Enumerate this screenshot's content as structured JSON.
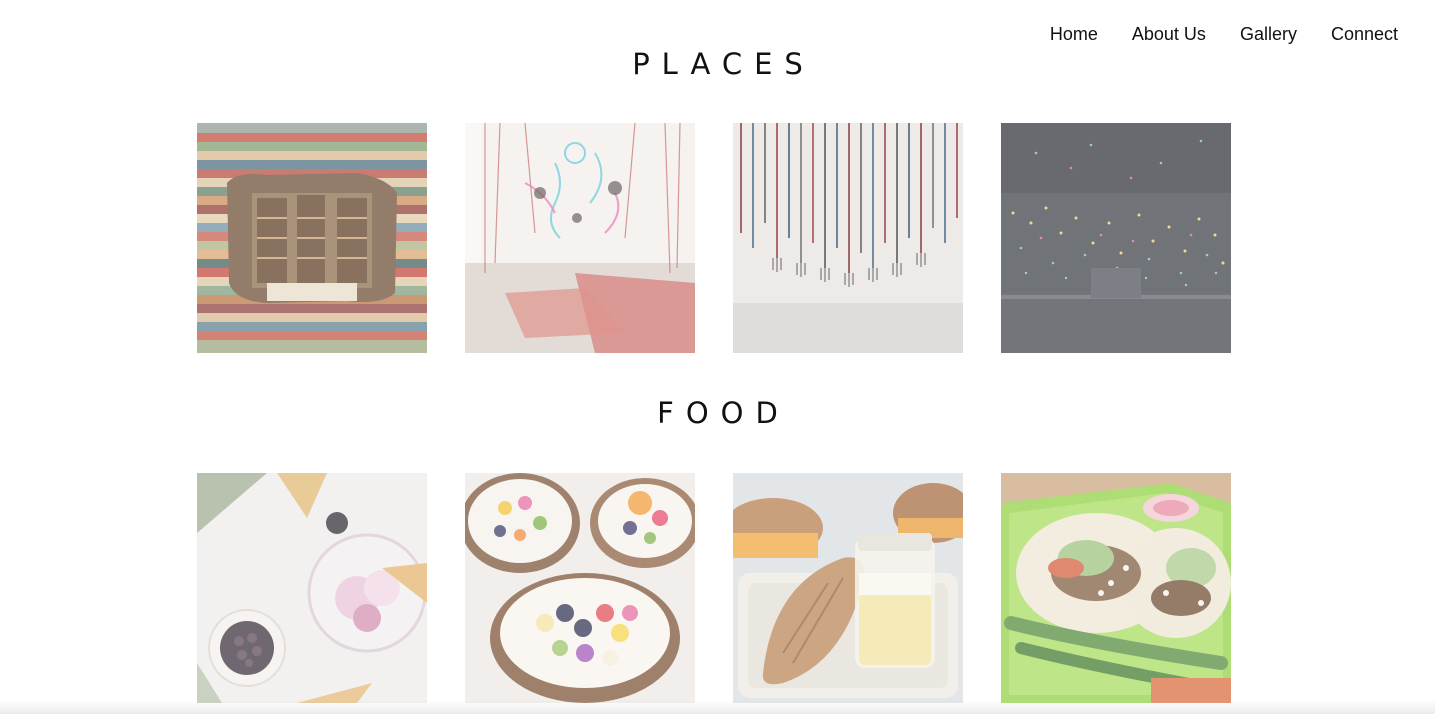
{
  "nav": {
    "items": [
      {
        "label": "Home"
      },
      {
        "label": "About Us"
      },
      {
        "label": "Gallery"
      },
      {
        "label": "Connect"
      }
    ]
  },
  "sections": {
    "places": {
      "title": "PLACES",
      "images": [
        {
          "icon": "bookstore-book-wall-photo"
        },
        {
          "icon": "neon-art-installation-photo"
        },
        {
          "icon": "hanging-pitchforks-installation-photo"
        },
        {
          "icon": "infinity-lights-room-photo"
        }
      ]
    },
    "food": {
      "title": "FOOD",
      "images": [
        {
          "icon": "ice-cream-berries-photo"
        },
        {
          "icon": "coconut-bowls-photo"
        },
        {
          "icon": "bread-and-jar-photo"
        },
        {
          "icon": "tacos-plate-photo"
        }
      ]
    }
  }
}
